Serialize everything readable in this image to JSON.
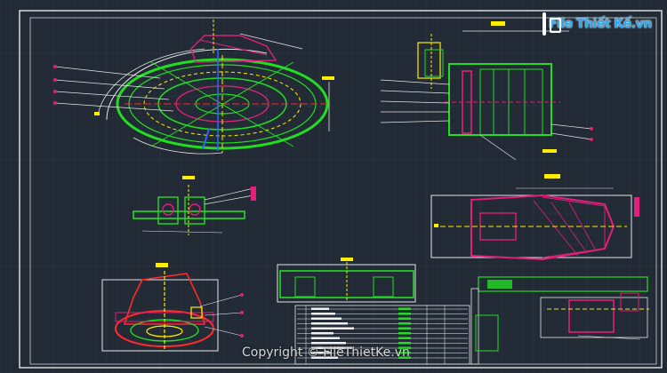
{
  "watermark": {
    "logo_text": "File Thiết Kế.vn"
  },
  "footer": {
    "copyright": "Copyright © FileThietKe.vn"
  },
  "colors": {
    "background": "#222a35",
    "grid": "#2e3744",
    "frame": "#e6e6e6",
    "green": "#22dd22",
    "magenta": "#e0207a",
    "yellow": "#ffee00",
    "red": "#ff2a2a",
    "white": "#f0f0f0",
    "blue": "#2a6bff"
  },
  "views": [
    {
      "id": "top-plan-circular",
      "depicts": "circular plan view"
    },
    {
      "id": "side-section-right",
      "depicts": "side assembly section"
    },
    {
      "id": "small-section-left",
      "depicts": "small cross section"
    },
    {
      "id": "cone-assembly",
      "depicts": "conical assembly elevation"
    },
    {
      "id": "dome-detail",
      "depicts": "dome detail view"
    },
    {
      "id": "base-elevation",
      "depicts": "base elevation with parts table"
    },
    {
      "id": "bottom-right-detail",
      "depicts": "bottom right detail"
    }
  ]
}
